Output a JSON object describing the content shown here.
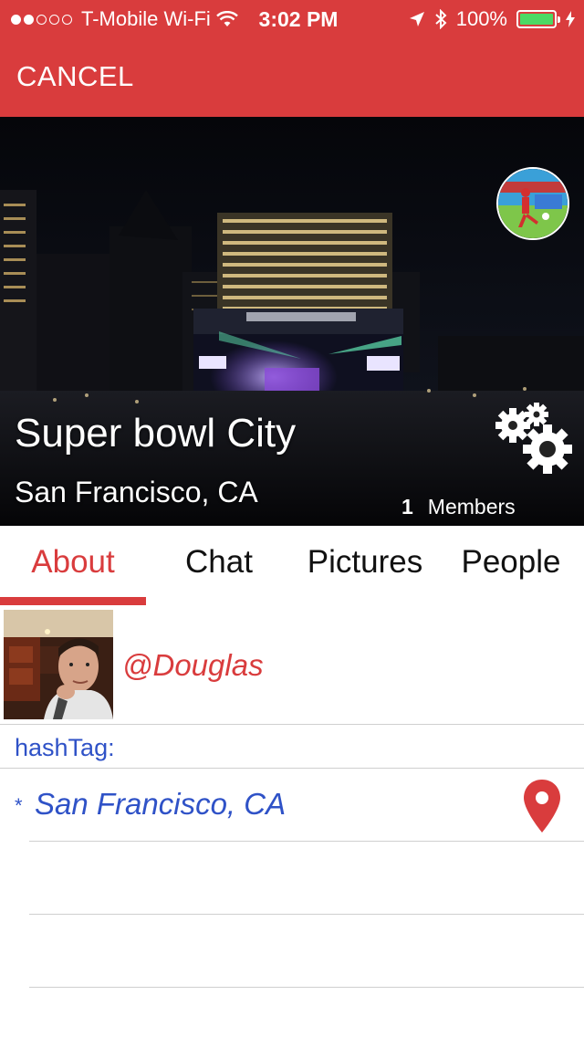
{
  "status_bar": {
    "carrier": "T-Mobile Wi-Fi",
    "time": "3:02 PM",
    "battery": "100%",
    "signal_bars_filled": 2,
    "signal_bars_total": 5
  },
  "nav": {
    "cancel_label": "CANCEL"
  },
  "hero": {
    "title": "Super bowl City",
    "location": "San Francisco, CA",
    "members_count": "1",
    "members_label": "Members"
  },
  "tabs": [
    {
      "label": "About",
      "active": true
    },
    {
      "label": "Chat",
      "active": false
    },
    {
      "label": "Pictures",
      "active": false
    },
    {
      "label": "People",
      "active": false
    }
  ],
  "creator": {
    "username": "@Douglas"
  },
  "details": {
    "hashtag_label": "hashTag:",
    "location_marker": "*",
    "location_name": "San Francisco, CA"
  },
  "colors": {
    "brand_red": "#d93c3d",
    "link_blue": "#2f52c7",
    "battery_green": "#4cd964"
  },
  "icons": {
    "location_services": "location-arrow-icon",
    "bluetooth": "bluetooth-icon",
    "wifi": "wifi-icon",
    "settings": "gears-icon",
    "map_pin": "map-pin-icon"
  }
}
